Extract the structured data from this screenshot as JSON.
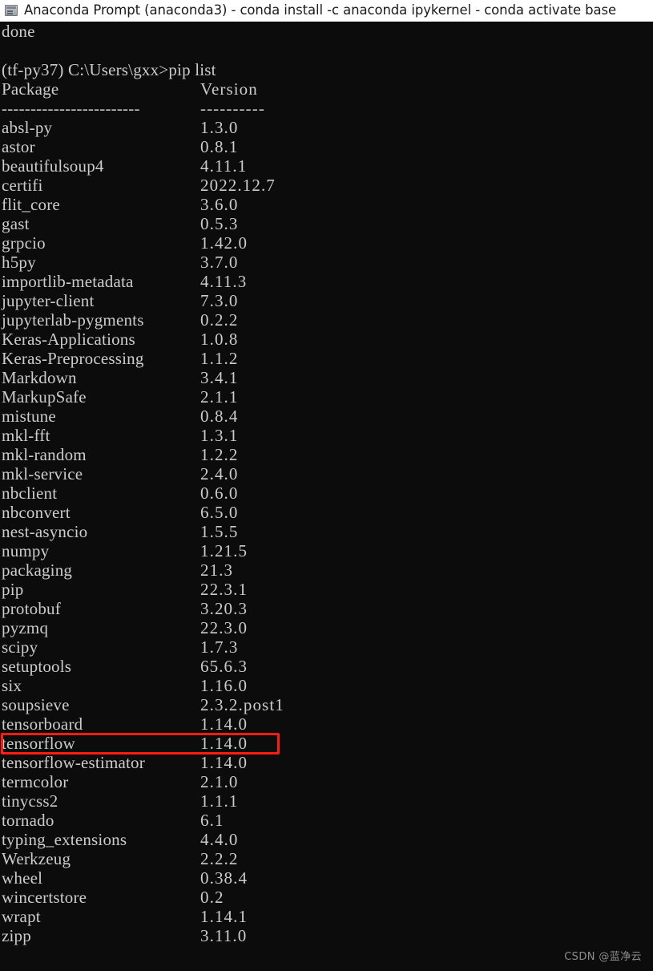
{
  "window": {
    "title": "Anaconda Prompt (anaconda3) - conda  install -c anaconda ipykernel - conda  activate base",
    "icon": "console-window-icon",
    "titlebar_bg": "#ffffff",
    "console_bg": "#0c0c0c",
    "console_fg": "#cccccc"
  },
  "terminal": {
    "line_done": "done",
    "line_blank": " ",
    "prompt_line": "(tf-py37) C:\\Users\\gxx>pip list",
    "header": {
      "package": "Package",
      "version": "Version"
    },
    "rule": {
      "package": "------------------------",
      "version": "----------"
    },
    "packages": [
      {
        "name": "absl-py",
        "version": "1.3.0"
      },
      {
        "name": "astor",
        "version": "0.8.1"
      },
      {
        "name": "beautifulsoup4",
        "version": "4.11.1"
      },
      {
        "name": "certifi",
        "version": "2022.12.7"
      },
      {
        "name": "flit_core",
        "version": "3.6.0"
      },
      {
        "name": "gast",
        "version": "0.5.3"
      },
      {
        "name": "grpcio",
        "version": "1.42.0"
      },
      {
        "name": "h5py",
        "version": "3.7.0"
      },
      {
        "name": "importlib-metadata",
        "version": "4.11.3"
      },
      {
        "name": "jupyter-client",
        "version": "7.3.0"
      },
      {
        "name": "jupyterlab-pygments",
        "version": "0.2.2"
      },
      {
        "name": "Keras-Applications",
        "version": "1.0.8"
      },
      {
        "name": "Keras-Preprocessing",
        "version": "1.1.2"
      },
      {
        "name": "Markdown",
        "version": "3.4.1"
      },
      {
        "name": "MarkupSafe",
        "version": "2.1.1"
      },
      {
        "name": "mistune",
        "version": "0.8.4"
      },
      {
        "name": "mkl-fft",
        "version": "1.3.1"
      },
      {
        "name": "mkl-random",
        "version": "1.2.2"
      },
      {
        "name": "mkl-service",
        "version": "2.4.0"
      },
      {
        "name": "nbclient",
        "version": "0.6.0"
      },
      {
        "name": "nbconvert",
        "version": "6.5.0"
      },
      {
        "name": "nest-asyncio",
        "version": "1.5.5"
      },
      {
        "name": "numpy",
        "version": "1.21.5"
      },
      {
        "name": "packaging",
        "version": "21.3"
      },
      {
        "name": "pip",
        "version": "22.3.1"
      },
      {
        "name": "protobuf",
        "version": "3.20.3"
      },
      {
        "name": "pyzmq",
        "version": "22.3.0"
      },
      {
        "name": "scipy",
        "version": "1.7.3"
      },
      {
        "name": "setuptools",
        "version": "65.6.3"
      },
      {
        "name": "six",
        "version": "1.16.0"
      },
      {
        "name": "soupsieve",
        "version": "2.3.2.post1"
      },
      {
        "name": "tensorboard",
        "version": "1.14.0"
      },
      {
        "name": "tensorflow",
        "version": "1.14.0"
      },
      {
        "name": "tensorflow-estimator",
        "version": "1.14.0"
      },
      {
        "name": "termcolor",
        "version": "2.1.0"
      },
      {
        "name": "tinycss2",
        "version": "1.1.1"
      },
      {
        "name": "tornado",
        "version": "6.1"
      },
      {
        "name": "typing_extensions",
        "version": "4.4.0"
      },
      {
        "name": "Werkzeug",
        "version": "2.2.2"
      },
      {
        "name": "wheel",
        "version": "0.38.4"
      },
      {
        "name": "wincertstore",
        "version": "0.2"
      },
      {
        "name": "wrapt",
        "version": "1.14.1"
      },
      {
        "name": "zipp",
        "version": "3.11.0"
      }
    ]
  },
  "annotation": {
    "highlight_target": "tensorflow",
    "highlight_color": "#ff1c13"
  },
  "watermark": {
    "text": "CSDN @蓝净云"
  }
}
